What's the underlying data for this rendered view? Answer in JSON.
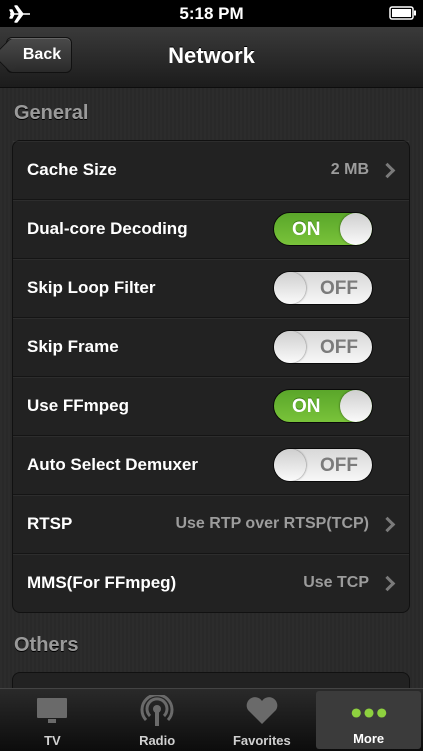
{
  "status_bar": {
    "time": "5:18 PM"
  },
  "nav": {
    "back_label": "Back",
    "title": "Network"
  },
  "sections": {
    "general_header": "General",
    "others_header": "Others"
  },
  "rows": [
    {
      "label": "Cache Size",
      "value": "2 MB",
      "type": "disclosure"
    },
    {
      "label": "Dual-core Decoding",
      "toggle": "ON",
      "type": "switch",
      "state": true
    },
    {
      "label": "Skip Loop Filter",
      "toggle": "OFF",
      "type": "switch",
      "state": false
    },
    {
      "label": "Skip Frame",
      "toggle": "OFF",
      "type": "switch",
      "state": false
    },
    {
      "label": "Use FFmpeg",
      "toggle": "ON",
      "type": "switch",
      "state": true
    },
    {
      "label": "Auto Select Demuxer",
      "toggle": "OFF",
      "type": "switch",
      "state": false
    },
    {
      "label": "RTSP",
      "value": "Use RTP over RTSP(TCP)",
      "type": "disclosure"
    },
    {
      "label": "MMS(For FFmpeg)",
      "value": "Use TCP",
      "type": "disclosure"
    }
  ],
  "tabs": [
    {
      "label": "TV",
      "icon": "tv-icon"
    },
    {
      "label": "Radio",
      "icon": "radio-icon"
    },
    {
      "label": "Favorites",
      "icon": "heart-icon"
    },
    {
      "label": "More",
      "icon": "more-dots-icon",
      "selected": true
    }
  ],
  "colors": {
    "switch_on": "#6bb832",
    "switch_off": "#eeeeee",
    "more_dots": "#8ed13f"
  }
}
